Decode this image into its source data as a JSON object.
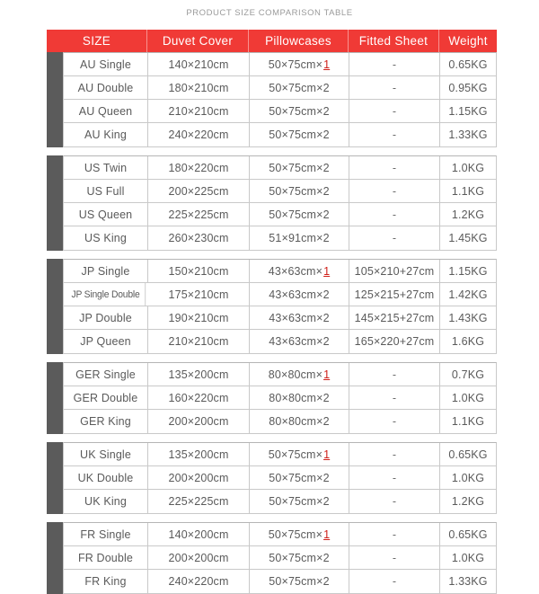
{
  "title": "PRODUCT SIZE COMPARISON TABLE",
  "colors": {
    "header_bg": "#f03a36",
    "header_text": "#ffffff",
    "group_bar": "#5b5b5b",
    "body_text": "#5a5a5a",
    "accent_qty": "#d0201a",
    "border": "#c9c9c9"
  },
  "columns": [
    {
      "key": "size",
      "label": "SIZE"
    },
    {
      "key": "duvet",
      "label": "Duvet  Cover"
    },
    {
      "key": "pillow",
      "label": "Pillowcases"
    },
    {
      "key": "fitted",
      "label": "Fitted Sheet"
    },
    {
      "key": "weight",
      "label": "Weight"
    }
  ],
  "groups": [
    {
      "name": "AU",
      "rows": [
        {
          "size": "AU Single",
          "duvet": "140×210cm",
          "pillow_base": "50×75cm×",
          "pillow_qty": "1",
          "qty_highlight": true,
          "fitted": "-",
          "weight": "0.65KG"
        },
        {
          "size": "AU Double",
          "duvet": "180×210cm",
          "pillow_base": "50×75cm×",
          "pillow_qty": "2",
          "qty_highlight": false,
          "fitted": "-",
          "weight": "0.95KG"
        },
        {
          "size": "AU Queen",
          "duvet": "210×210cm",
          "pillow_base": "50×75cm×",
          "pillow_qty": "2",
          "qty_highlight": false,
          "fitted": "-",
          "weight": "1.15KG"
        },
        {
          "size": "AU  King",
          "duvet": "240×220cm",
          "pillow_base": "50×75cm×",
          "pillow_qty": "2",
          "qty_highlight": false,
          "fitted": "-",
          "weight": "1.33KG"
        }
      ]
    },
    {
      "name": "US",
      "rows": [
        {
          "size": "US Twin",
          "duvet": "180×220cm",
          "pillow_base": "50×75cm×",
          "pillow_qty": "2",
          "qty_highlight": false,
          "fitted": "-",
          "weight": "1.0KG"
        },
        {
          "size": "US Full",
          "duvet": "200×225cm",
          "pillow_base": "50×75cm×",
          "pillow_qty": "2",
          "qty_highlight": false,
          "fitted": "-",
          "weight": "1.1KG"
        },
        {
          "size": "US Queen",
          "duvet": "225×225cm",
          "pillow_base": "50×75cm×",
          "pillow_qty": "2",
          "qty_highlight": false,
          "fitted": "-",
          "weight": "1.2KG"
        },
        {
          "size": "US King",
          "duvet": "260×230cm",
          "pillow_base": "51×91cm×",
          "pillow_qty": "2",
          "qty_highlight": false,
          "fitted": "-",
          "weight": "1.45KG"
        }
      ]
    },
    {
      "name": "JP",
      "rows": [
        {
          "size": "JP Single",
          "condensed": false,
          "duvet": "150×210cm",
          "pillow_base": "43×63cm×",
          "pillow_qty": "1",
          "qty_highlight": true,
          "fitted": "105×210+27cm",
          "weight": "1.15KG"
        },
        {
          "size": "JP Single Double",
          "condensed": true,
          "duvet": "175×210cm",
          "pillow_base": "43×63cm×",
          "pillow_qty": "2",
          "qty_highlight": false,
          "fitted": "125×215+27cm",
          "weight": "1.42KG"
        },
        {
          "size": "JP Double",
          "condensed": false,
          "duvet": "190×210cm",
          "pillow_base": "43×63cm×",
          "pillow_qty": "2",
          "qty_highlight": false,
          "fitted": "145×215+27cm",
          "weight": "1.43KG"
        },
        {
          "size": "JP Queen",
          "condensed": false,
          "duvet": "210×210cm",
          "pillow_base": "43×63cm×",
          "pillow_qty": "2",
          "qty_highlight": false,
          "fitted": "165×220+27cm",
          "weight": "1.6KG"
        }
      ]
    },
    {
      "name": "GER",
      "rows": [
        {
          "size": "GER Single",
          "duvet": "135×200cm",
          "pillow_base": "80×80cm×",
          "pillow_qty": "1",
          "qty_highlight": true,
          "fitted": "-",
          "weight": "0.7KG"
        },
        {
          "size": "GER Double",
          "duvet": "160×220cm",
          "pillow_base": "80×80cm×",
          "pillow_qty": "2",
          "qty_highlight": false,
          "fitted": "-",
          "weight": "1.0KG"
        },
        {
          "size": "GER King",
          "duvet": "200×200cm",
          "pillow_base": "80×80cm×",
          "pillow_qty": "2",
          "qty_highlight": false,
          "fitted": "-",
          "weight": "1.1KG"
        }
      ]
    },
    {
      "name": "UK",
      "rows": [
        {
          "size": "UK Single",
          "duvet": "135×200cm",
          "pillow_base": "50×75cm×",
          "pillow_qty": "1",
          "qty_highlight": true,
          "fitted": "-",
          "weight": "0.65KG"
        },
        {
          "size": "UK Double",
          "duvet": "200×200cm",
          "pillow_base": "50×75cm×",
          "pillow_qty": "2",
          "qty_highlight": false,
          "fitted": "-",
          "weight": "1.0KG"
        },
        {
          "size": "UK King",
          "duvet": "225×225cm",
          "pillow_base": "50×75cm×",
          "pillow_qty": "2",
          "qty_highlight": false,
          "fitted": "-",
          "weight": "1.2KG"
        }
      ]
    },
    {
      "name": "FR",
      "rows": [
        {
          "size": "FR Single",
          "duvet": "140×200cm",
          "pillow_base": "50×75cm×",
          "pillow_qty": "1",
          "qty_highlight": true,
          "fitted": "-",
          "weight": "0.65KG"
        },
        {
          "size": "FR Double",
          "duvet": "200×200cm",
          "pillow_base": "50×75cm×",
          "pillow_qty": "2",
          "qty_highlight": false,
          "fitted": "-",
          "weight": "1.0KG"
        },
        {
          "size": "FR King",
          "duvet": "240×220cm",
          "pillow_base": "50×75cm×",
          "pillow_qty": "2",
          "qty_highlight": false,
          "fitted": "-",
          "weight": "1.33KG"
        }
      ]
    }
  ]
}
